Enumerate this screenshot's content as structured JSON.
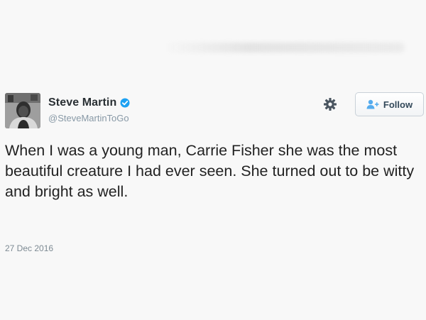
{
  "tweet": {
    "author": {
      "display_name": "Steve Martin",
      "handle": "@SteveMartinToGo",
      "verified": true
    },
    "follow_button": {
      "label": "Follow"
    },
    "text": "When I was a young man, Carrie Fisher she was the most beautiful creature I had ever seen. She turned out to be witty and bright as well.",
    "date": "27 Dec 2016"
  },
  "icons": {
    "verified": "verified-badge-icon",
    "settings": "gear-icon",
    "follow": "add-user-icon"
  },
  "colors": {
    "verified_blue": "#1da1f2",
    "follow_icon_blue": "#55acee",
    "name_text": "#292f33",
    "secondary_text": "#8899a6"
  }
}
